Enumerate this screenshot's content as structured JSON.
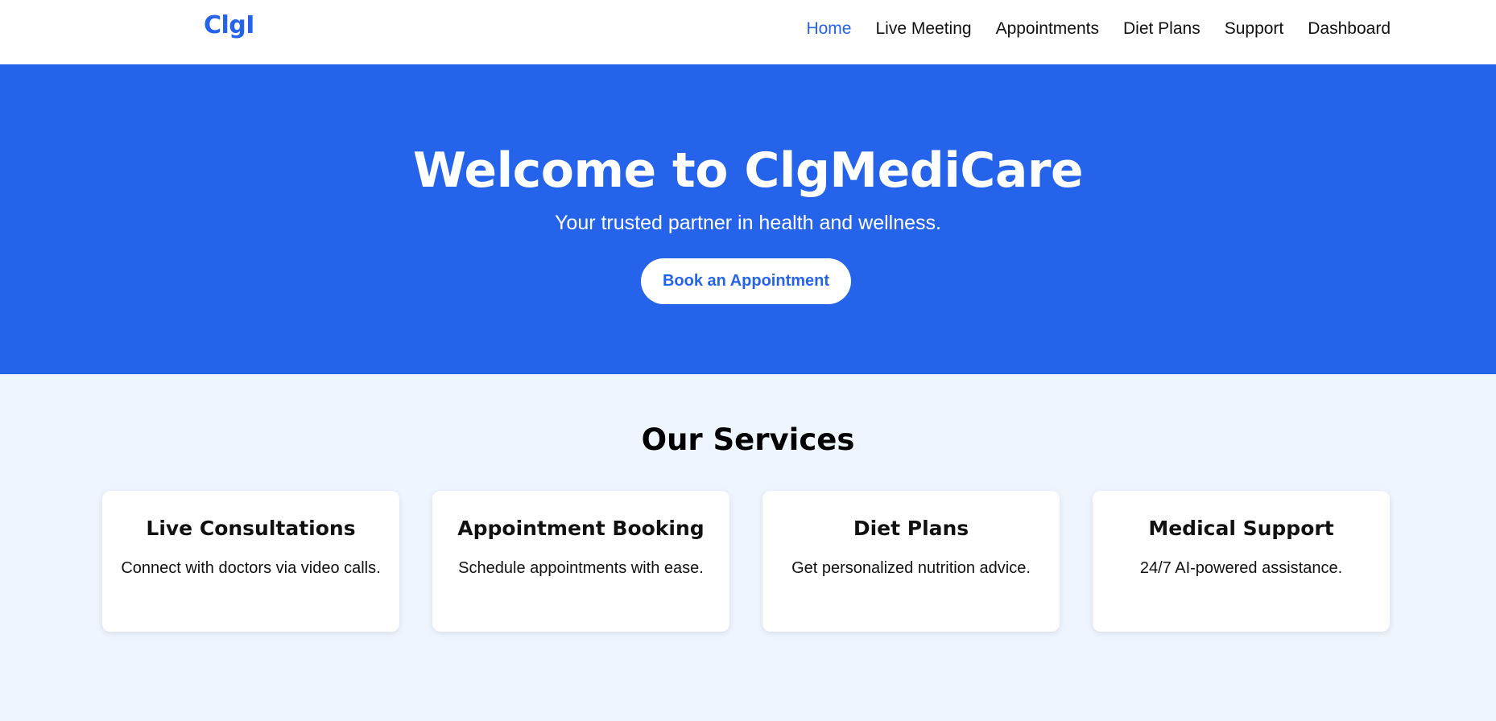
{
  "navbar": {
    "logo": "ClgI",
    "links": [
      {
        "label": "Home",
        "active": true
      },
      {
        "label": "Live Meeting",
        "active": false
      },
      {
        "label": "Appointments",
        "active": false
      },
      {
        "label": "Diet Plans",
        "active": false
      },
      {
        "label": "Support",
        "active": false
      },
      {
        "label": "Dashboard",
        "active": false
      }
    ]
  },
  "hero": {
    "title": "Welcome to ClgMediCare",
    "subtitle": "Your trusted partner in health and wellness.",
    "button_label": "Book an Appointment"
  },
  "services": {
    "title": "Our Services",
    "cards": [
      {
        "title": "Live Consultations",
        "text": "Connect with doctors via video calls."
      },
      {
        "title": "Appointment Booking",
        "text": "Schedule appointments with ease."
      },
      {
        "title": "Diet Plans",
        "text": "Get personalized nutrition advice."
      },
      {
        "title": "Medical Support",
        "text": "24/7 AI-powered assistance."
      }
    ]
  },
  "colors": {
    "brand": "#2563eb",
    "page_background": "#eef5ff",
    "card_background": "#ffffff"
  }
}
